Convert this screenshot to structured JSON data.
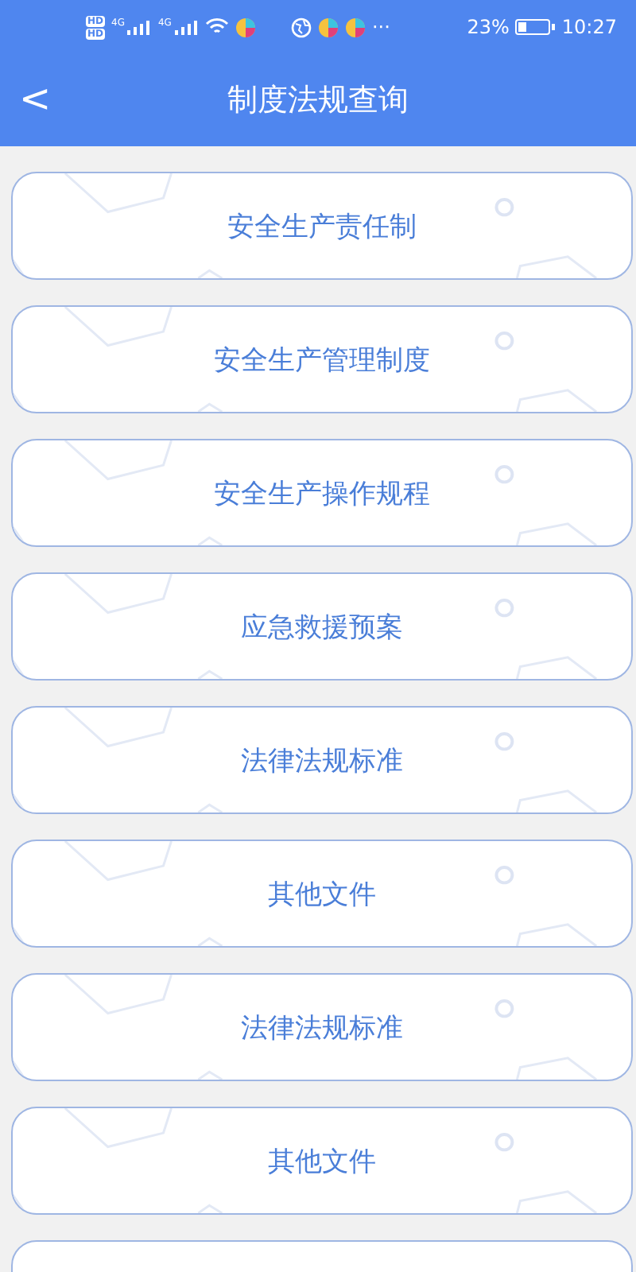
{
  "status_bar": {
    "hd_badges": [
      "HD",
      "HD"
    ],
    "network_labels": [
      "4G",
      "4G"
    ],
    "battery_text": "23%",
    "battery": {
      "level": 0.23
    },
    "time": "10:27",
    "more": "···"
  },
  "header": {
    "title": "制度法规查询",
    "back": "<"
  },
  "items": [
    {
      "label": "安全生产责任制"
    },
    {
      "label": "安全生产管理制度"
    },
    {
      "label": "安全生产操作规程"
    },
    {
      "label": "应急救援预案"
    },
    {
      "label": "法律法规标准"
    },
    {
      "label": "其他文件"
    },
    {
      "label": "法律法规标准"
    },
    {
      "label": "其他文件"
    }
  ],
  "more_below": true
}
